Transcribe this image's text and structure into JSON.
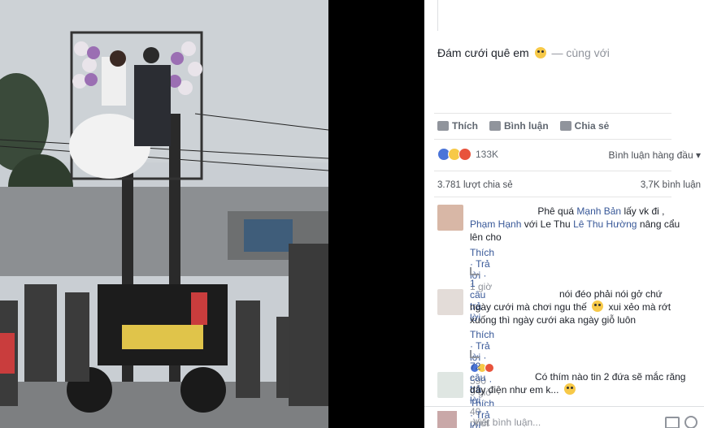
{
  "post": {
    "caption": "Đám cưới quê em",
    "with_text": "— cùng với"
  },
  "actions": {
    "like": "Thích",
    "comment": "Bình luận",
    "share": "Chia sẻ"
  },
  "reactions": {
    "count": "133K",
    "sort": "Bình luận hàng đầu"
  },
  "stats": {
    "shares": "3.781 lượt chia sẻ",
    "comments": "3,7K bình luận"
  },
  "comments": [
    {
      "text_start": "Phê quá",
      "link1": "Mạnh Bản",
      "text_mid": "lấy vk đi ,",
      "link2": "Phạm Hạnh",
      "text_with": "với Le Thu",
      "link3": "Lê Thu Hường",
      "text_end": "nâng cẩu lên cho",
      "like_label": "Thích",
      "reply_label": "Trả lời",
      "time": "1 giờ",
      "replies": "1 câu trả lời"
    },
    {
      "line1": "nói đéo phải nói gở chứ",
      "line2a": "ngày cưới mà chơi ngu thế",
      "line2b": "xui xẻo mà rớt",
      "line3": "xuống thì ngày cưới aka ngày giỗ luôn",
      "like_label": "Thích",
      "reply_label": "Trả lời",
      "react_count": "590",
      "time": "9 giờ",
      "replies": "72 câu trả lời",
      "replies_time": "40 phút"
    },
    {
      "line1": "Có thím nào tin 2 đứa sẽ mắc răng",
      "line2": "dây điện như em k...",
      "like_label": "Thích",
      "reply_label": "Trả lời"
    }
  ],
  "composer": {
    "placeholder": "Viết bình luận..."
  }
}
